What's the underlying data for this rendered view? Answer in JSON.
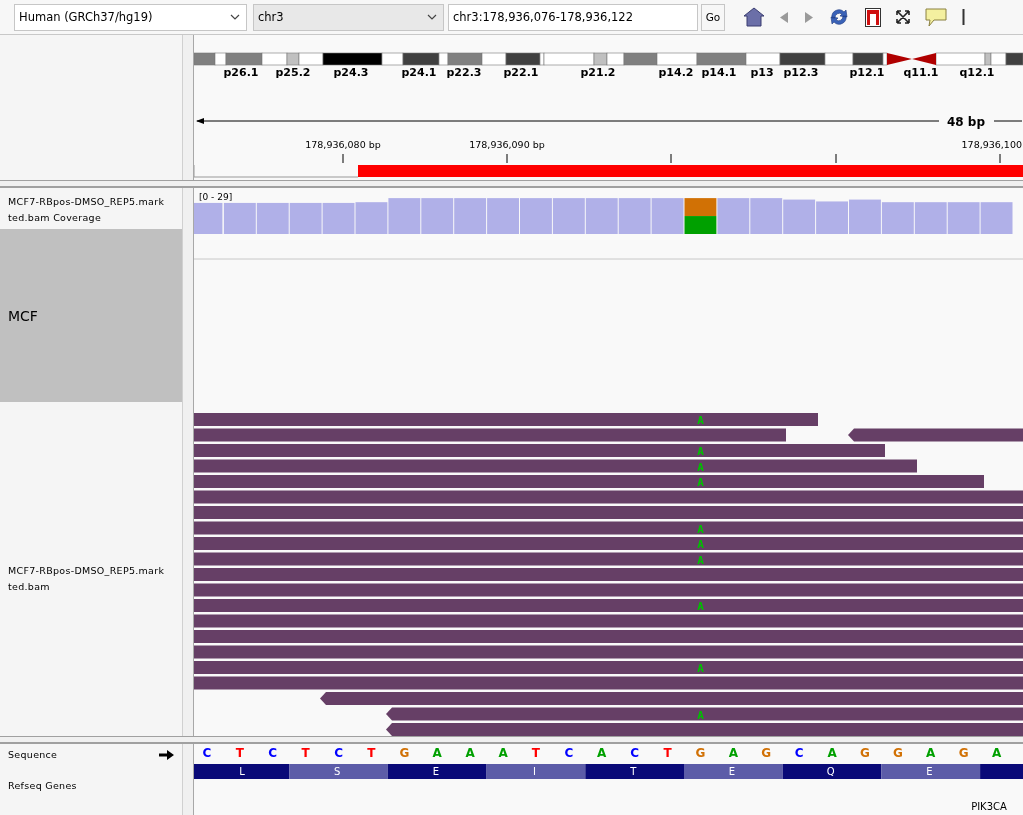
{
  "toolbar": {
    "genome": "Human (GRCh37/hg19)",
    "chromosome": "chr3",
    "locus": "chr3:178,936,076-178,936,122",
    "go_button": "Go"
  },
  "ideogram": {
    "bands": [
      "p26.1",
      "p25.2",
      "p24.3",
      "p24.1",
      "p22.3",
      "p22.1",
      "p21.2",
      "p14.2",
      "p14.1",
      "p13",
      "p12.3",
      "p12.1",
      "q11.1",
      "q12.1"
    ]
  },
  "ruler": {
    "span": "48 bp",
    "ticks": [
      "178,936,080 bp",
      "178,936,090 bp",
      "178,936,100"
    ]
  },
  "coverage": {
    "name_lines": [
      "MCF7-RBpos-DMSO_REP5.mark",
      "ted.bam Coverage"
    ],
    "range": "[0 - 29]",
    "bars": [
      {
        "kind": "reference"
      },
      {
        "kind": "reference"
      },
      {
        "kind": "reference"
      },
      {
        "kind": "reference"
      },
      {
        "kind": "reference"
      },
      {
        "kind": "reference"
      },
      {
        "kind": "reference"
      },
      {
        "kind": "reference"
      },
      {
        "kind": "reference"
      },
      {
        "kind": "reference"
      },
      {
        "kind": "reference"
      },
      {
        "kind": "reference"
      },
      {
        "kind": "reference"
      },
      {
        "kind": "reference"
      },
      {
        "kind": "reference"
      },
      {
        "kind": "mismatch"
      },
      {
        "kind": "reference"
      },
      {
        "kind": "reference"
      },
      {
        "kind": "reference"
      },
      {
        "kind": "reference"
      },
      {
        "kind": "reference"
      },
      {
        "kind": "reference"
      },
      {
        "kind": "reference"
      },
      {
        "kind": "reference"
      },
      {
        "kind": "reference"
      }
    ]
  },
  "collapsed_label": "MCF",
  "alignments": {
    "name_lines": [
      "MCF7-RBpos-DMSO_REP5.mark",
      "ted.bam"
    ],
    "rows": [
      {
        "reads": [
          {
            "reverse": false,
            "mismatch": "A"
          }
        ]
      },
      {
        "reads": [
          {
            "reverse": false
          },
          {
            "reverse": true
          }
        ]
      },
      {
        "reads": [
          {
            "reverse": false,
            "mismatch": "A"
          }
        ]
      },
      {
        "reads": [
          {
            "reverse": false,
            "mismatch": "A"
          }
        ]
      },
      {
        "reads": [
          {
            "reverse": false,
            "mismatch": "A"
          }
        ]
      },
      {
        "reads": [
          {
            "reverse": false
          }
        ]
      },
      {
        "reads": [
          {
            "reverse": false
          }
        ]
      },
      {
        "reads": [
          {
            "reverse": false,
            "mismatch": "A"
          }
        ]
      },
      {
        "reads": [
          {
            "reverse": false,
            "mismatch": "A"
          }
        ]
      },
      {
        "reads": [
          {
            "reverse": false,
            "mismatch": "A"
          }
        ]
      },
      {
        "reads": [
          {
            "reverse": false
          }
        ]
      },
      {
        "reads": [
          {
            "reverse": false
          }
        ]
      },
      {
        "reads": [
          {
            "reverse": false,
            "mismatch": "A"
          }
        ]
      },
      {
        "reads": [
          {
            "reverse": false
          }
        ]
      },
      {
        "reads": [
          {
            "reverse": false
          }
        ]
      },
      {
        "reads": [
          {
            "reverse": false
          }
        ]
      },
      {
        "reads": [
          {
            "reverse": false,
            "mismatch": "A"
          }
        ]
      },
      {
        "reads": [
          {
            "reverse": false
          }
        ]
      },
      {
        "reads": [
          {
            "reverse": true
          }
        ]
      },
      {
        "reads": [
          {
            "reverse": true,
            "mismatch": "A"
          }
        ]
      },
      {
        "reads": [
          {
            "reverse": true
          }
        ]
      }
    ]
  },
  "sequence": {
    "name": "Sequence",
    "bases": [
      {
        "base": "C",
        "color": "#0000ff"
      },
      {
        "base": "T",
        "color": "#ff0000"
      },
      {
        "base": "C",
        "color": "#0000ff"
      },
      {
        "base": "T",
        "color": "#ff0000"
      },
      {
        "base": "C",
        "color": "#0000ff"
      },
      {
        "base": "T",
        "color": "#ff0000"
      },
      {
        "base": "G",
        "color": "#d17105"
      },
      {
        "base": "A",
        "color": "#00a000"
      },
      {
        "base": "A",
        "color": "#00a000"
      },
      {
        "base": "A",
        "color": "#00a000"
      },
      {
        "base": "T",
        "color": "#ff0000"
      },
      {
        "base": "C",
        "color": "#0000ff"
      },
      {
        "base": "A",
        "color": "#00a000"
      },
      {
        "base": "C",
        "color": "#0000ff"
      },
      {
        "base": "T",
        "color": "#ff0000"
      },
      {
        "base": "G",
        "color": "#d17105"
      },
      {
        "base": "A",
        "color": "#00a000"
      },
      {
        "base": "G",
        "color": "#d17105"
      },
      {
        "base": "C",
        "color": "#0000ff"
      },
      {
        "base": "A",
        "color": "#00a000"
      },
      {
        "base": "G",
        "color": "#d17105"
      },
      {
        "base": "G",
        "color": "#d17105"
      },
      {
        "base": "A",
        "color": "#00a000"
      },
      {
        "base": "G",
        "color": "#d17105"
      },
      {
        "base": "A",
        "color": "#00a000"
      }
    ]
  },
  "genes": {
    "name": "Refseq Genes",
    "amino_acids": [
      "L",
      "S",
      "E",
      "I",
      "T",
      "E",
      "Q",
      "E"
    ],
    "gene": "PIK3CA"
  }
}
